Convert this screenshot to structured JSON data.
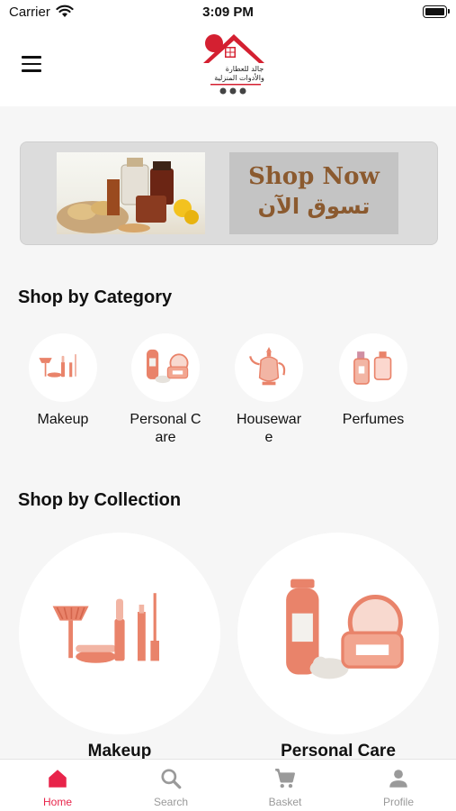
{
  "status": {
    "carrier": "Carrier",
    "time": "3:09 PM"
  },
  "header": {
    "logo_text_line1": "جالد للعطارة",
    "logo_text_line2": "والأدوات المنزلية"
  },
  "banner": {
    "cta_en": "Shop Now",
    "cta_ar": "تسوق الآن"
  },
  "sections": {
    "category_title": "Shop by Category",
    "collection_title": "Shop by Collection"
  },
  "categories": [
    {
      "label": "Makeup",
      "icon": "makeup-icon"
    },
    {
      "label": "Personal Care",
      "icon": "personal-care-icon"
    },
    {
      "label": "Houseware",
      "icon": "teapot-icon"
    },
    {
      "label": "Perfumes",
      "icon": "perfume-icon"
    }
  ],
  "collections": [
    {
      "label": "Makeup",
      "icon": "makeup-icon"
    },
    {
      "label": "Personal Care",
      "icon": "personal-care-icon"
    }
  ],
  "tabs": [
    {
      "label": "Home",
      "icon": "home-icon",
      "active": true
    },
    {
      "label": "Search",
      "icon": "search-icon",
      "active": false
    },
    {
      "label": "Basket",
      "icon": "cart-icon",
      "active": false
    },
    {
      "label": "Profile",
      "icon": "person-icon",
      "active": false
    }
  ],
  "colors": {
    "accent": "#e8244a",
    "illustration": "#e9836a",
    "banner_text": "#8b5a2f"
  }
}
